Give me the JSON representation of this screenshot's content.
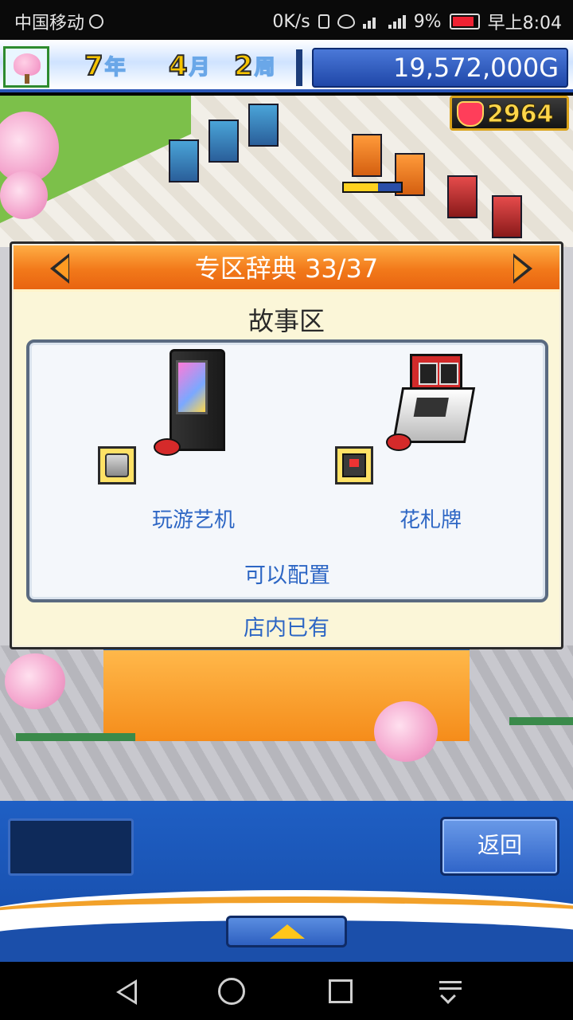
{
  "status_bar": {
    "carrier": "中国移动",
    "speed": "0K/s",
    "network": "4G",
    "battery": "9%",
    "time": "早上8:04"
  },
  "hud": {
    "year_num": "7",
    "year_unit": "年",
    "month_num": "4",
    "month_unit": "月",
    "week_num": "2",
    "week_unit": "周",
    "money": "19,572,000G",
    "popularity": "2964"
  },
  "dialog": {
    "title": "专区辞典 33/37",
    "zone_name": "故事区",
    "machines": [
      {
        "label": "玩游艺机",
        "icon": "pachinko-machine-icon"
      },
      {
        "label": "花札牌",
        "icon": "hanafuda-machine-icon"
      }
    ],
    "placeable_text": "可以配置",
    "in_store_text": "店内已有"
  },
  "bottom_bar": {
    "back_label": "返回"
  },
  "colors": {
    "dialog_header": "#f2791a",
    "link_text": "#2d66c4",
    "hud_bar": "#2a55b8"
  }
}
